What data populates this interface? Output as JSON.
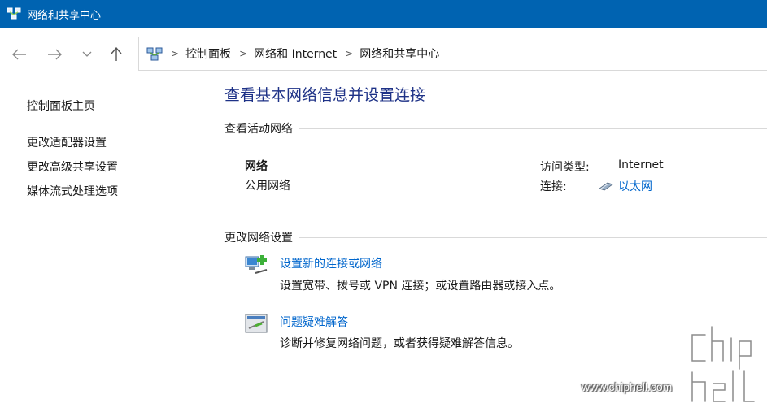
{
  "window": {
    "title": "网络和共享中心"
  },
  "nav": {
    "back_icon": "arrow-left-icon",
    "forward_icon": "arrow-right-icon",
    "recent_icon": "chevron-down-icon",
    "up_icon": "arrow-up-icon"
  },
  "breadcrumb": [
    "控制面板",
    "网络和 Internet",
    "网络和共享中心"
  ],
  "sidebar": {
    "home": "控制面板主页",
    "items": [
      "更改适配器设置",
      "更改高级共享设置",
      "媒体流式处理选项"
    ]
  },
  "main": {
    "title": "查看基本网络信息并设置连接",
    "active_section": "查看活动网络",
    "network": {
      "name": "网络",
      "type": "公用网络",
      "access_label": "访问类型:",
      "access_value": "Internet",
      "connection_label": "连接:",
      "connection_value": "以太网"
    },
    "change_section": "更改网络设置",
    "tasks": [
      {
        "link": "设置新的连接或网络",
        "desc": "设置宽带、拨号或 VPN 连接；或设置路由器或接入点。",
        "icon": "new-connection-icon"
      },
      {
        "link": "问题疑难解答",
        "desc": "诊断并修复网络问题，或者获得疑难解答信息。",
        "icon": "troubleshoot-icon"
      }
    ]
  },
  "watermark": {
    "url": "www.chiphell.com"
  },
  "colors": {
    "titlebar": "#0063b1",
    "link": "#0066cc",
    "heading": "#1e3287"
  }
}
